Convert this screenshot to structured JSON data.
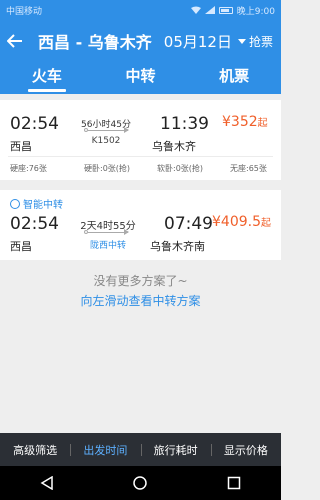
{
  "status_bar": {
    "carrier": "中国移动",
    "time": "晚上9:00"
  },
  "header": {
    "route": "西昌 - 乌鲁木齐",
    "date": "05月12日",
    "grab": "抢票"
  },
  "tabs": [
    {
      "label": "火车",
      "active": true
    },
    {
      "label": "中转",
      "active": false
    },
    {
      "label": "机票",
      "active": false
    }
  ],
  "results": [
    {
      "depart_time": "02:54",
      "depart_station": "西昌",
      "duration": "56小时45分",
      "train_no": "K1502",
      "arrive_time": "11:39",
      "arrive_station": "乌鲁木齐",
      "price": "¥352",
      "price_suffix": "起",
      "seats": [
        "硬座:76张",
        "硬卧:0张(抢)",
        "软卧:0张(抢)",
        "无座:65张"
      ]
    }
  ],
  "transfer": {
    "label": "智能中转",
    "depart_time": "02:54",
    "depart_station": "西昌",
    "duration": "2天4时55分",
    "via": "陇西中转",
    "arrive_time": "07:49",
    "arrive_station": "乌鲁木齐南",
    "price": "¥409.5",
    "price_suffix": "起"
  },
  "messages": {
    "no_more": "没有更多方案了~",
    "swipe_hint": "向左滑动查看中转方案"
  },
  "filters": [
    {
      "label": "高级筛选",
      "active": false
    },
    {
      "label": "出发时间",
      "active": true
    },
    {
      "label": "旅行耗时",
      "active": false
    },
    {
      "label": "显示价格",
      "active": false
    }
  ],
  "colors": {
    "primary": "#2f8fe6",
    "price": "#f05f2a",
    "filter_bg": "#2b2f35"
  }
}
